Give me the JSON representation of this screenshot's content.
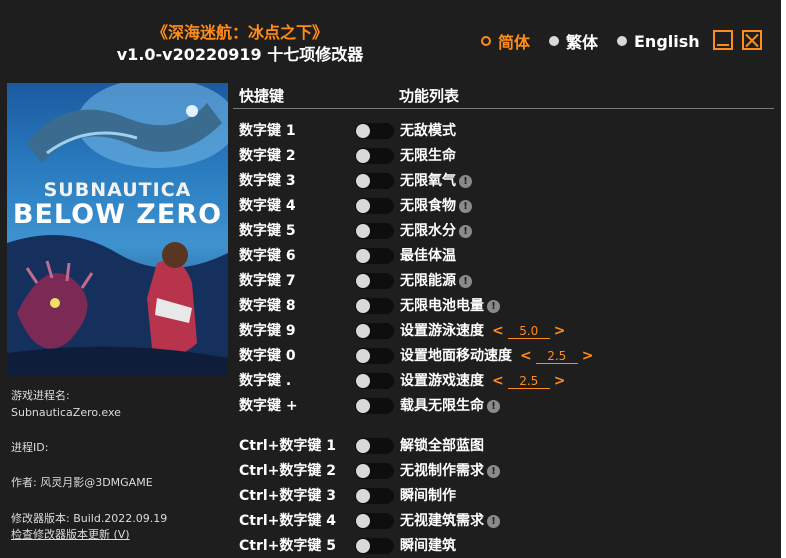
{
  "title": {
    "main": "《深海迷航：冰点之下》",
    "sub": "v1.0-v20220919 十七项修改器"
  },
  "languages": [
    {
      "label": "简体",
      "active": true
    },
    {
      "label": "繁体",
      "active": false
    },
    {
      "label": "English",
      "active": false
    }
  ],
  "window_buttons": {
    "minimize": "minimize-icon",
    "close": "close-icon"
  },
  "cover": {
    "logo_line1": "SUBNAUTICA",
    "logo_line2": "BELOW ZERO"
  },
  "info": {
    "process_label": "游戏进程名:",
    "process_value": "SubnauticaZero.exe",
    "pid_label": "进程ID:",
    "author": "作者: 风灵月影@3DMGAME",
    "version": "修改器版本: Build.2022.09.19",
    "update_link": "检查修改器版本更新 (V)"
  },
  "headers": {
    "hotkey": "快捷键",
    "function": "功能列表"
  },
  "cheats": [
    {
      "key": "数字键 1",
      "label": "无敌模式",
      "warn": false,
      "on": false
    },
    {
      "key": "数字键 2",
      "label": "无限生命",
      "warn": false,
      "on": false
    },
    {
      "key": "数字键 3",
      "label": "无限氧气",
      "warn": true,
      "on": false
    },
    {
      "key": "数字键 4",
      "label": "无限食物",
      "warn": true,
      "on": false
    },
    {
      "key": "数字键 5",
      "label": "无限水分",
      "warn": true,
      "on": false
    },
    {
      "key": "数字键 6",
      "label": "最佳体温",
      "warn": false,
      "on": false
    },
    {
      "key": "数字键 7",
      "label": "无限能源",
      "warn": true,
      "on": false
    },
    {
      "key": "数字键 8",
      "label": "无限电池电量",
      "warn": true,
      "on": false
    },
    {
      "key": "数字键 9",
      "label": "设置游泳速度",
      "warn": false,
      "on": false,
      "value": "5.0"
    },
    {
      "key": "数字键 0",
      "label": "设置地面移动速度",
      "warn": false,
      "on": false,
      "value": "2.5"
    },
    {
      "key": "数字键 .",
      "label": "设置游戏速度",
      "warn": false,
      "on": false,
      "value": "2.5"
    },
    {
      "key": "数字键 +",
      "label": "载具无限生命",
      "warn": true,
      "on": false
    },
    {
      "key": "Ctrl+数字键 1",
      "label": "解锁全部蓝图",
      "warn": false,
      "on": false
    },
    {
      "key": "Ctrl+数字键 2",
      "label": "无视制作需求",
      "warn": true,
      "on": false
    },
    {
      "key": "Ctrl+数字键 3",
      "label": "瞬间制作",
      "warn": false,
      "on": false
    },
    {
      "key": "Ctrl+数字键 4",
      "label": "无视建筑需求",
      "warn": true,
      "on": false
    },
    {
      "key": "Ctrl+数字键 5",
      "label": "瞬间建筑",
      "warn": false,
      "on": false
    }
  ],
  "colors": {
    "accent": "#ff8c1a",
    "background": "#1e1e1e",
    "text": "#ffffff"
  }
}
